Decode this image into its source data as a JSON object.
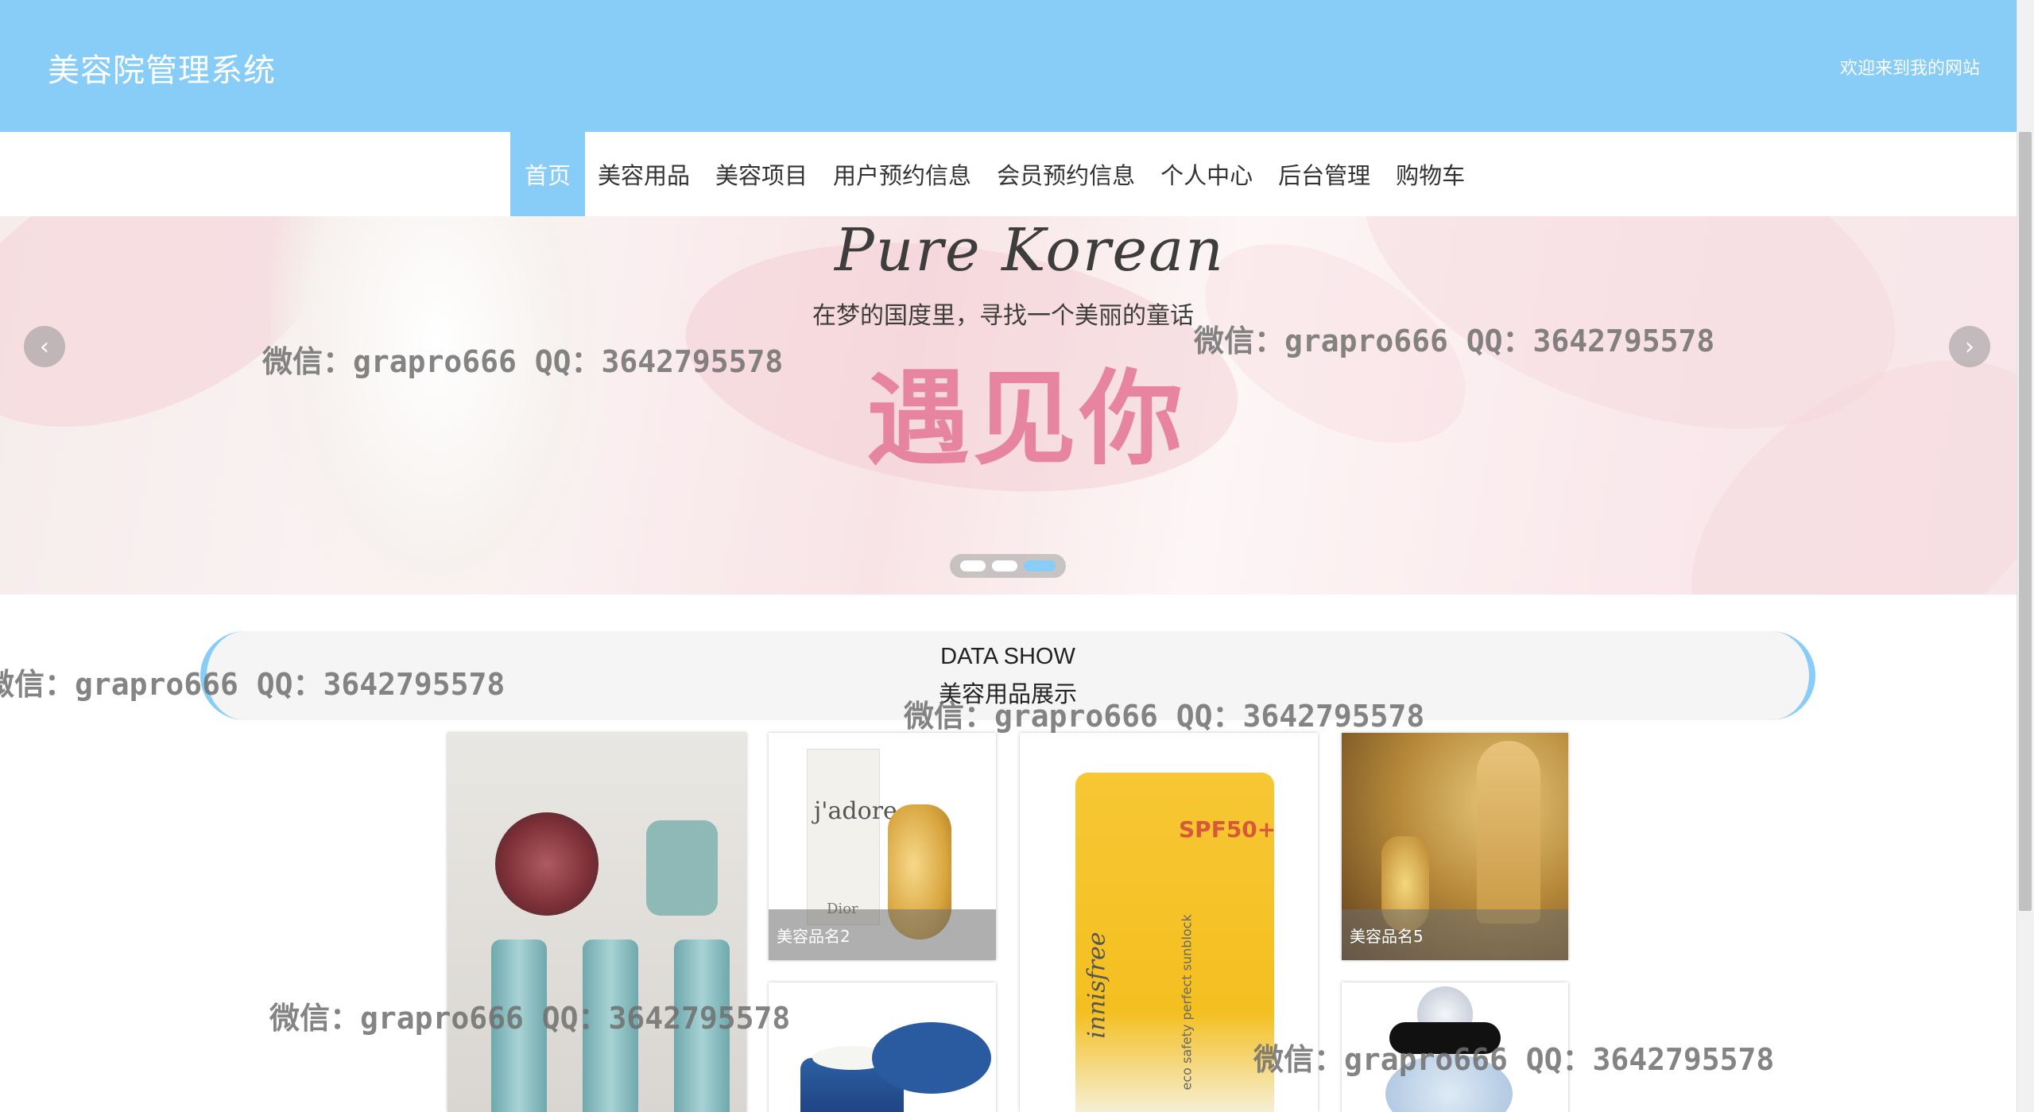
{
  "header": {
    "site_title": "美容院管理系统",
    "welcome": "欢迎来到我的网站"
  },
  "nav": {
    "items": [
      {
        "label": "首页",
        "active": true
      },
      {
        "label": "美容用品",
        "active": false
      },
      {
        "label": "美容项目",
        "active": false
      },
      {
        "label": "用户预约信息",
        "active": false
      },
      {
        "label": "会员预约信息",
        "active": false
      },
      {
        "label": "个人中心",
        "active": false
      },
      {
        "label": "后台管理",
        "active": false
      },
      {
        "label": "购物车",
        "active": false
      }
    ]
  },
  "banner": {
    "script_title": "Pure Korean",
    "subtitle": "在梦的国度里，寻找一个美丽的童话",
    "big_text": "遇见你",
    "prev_icon": "chevron-left-icon",
    "next_icon": "chevron-right-icon",
    "prev_glyph": "‹",
    "next_glyph": "›",
    "slide_count": 3,
    "active_slide": 3
  },
  "section": {
    "title_en": "DATA SHOW",
    "title_cn": "美容用品展示"
  },
  "products": [
    {
      "caption": ""
    },
    {
      "caption": "美容品名2"
    },
    {
      "caption": ""
    },
    {
      "caption": "美容品名5"
    },
    {
      "caption": ""
    },
    {
      "caption": ""
    }
  ],
  "product_art": {
    "jadore": "j'adore",
    "dior": "Dior",
    "spf": "SPF50+",
    "innisfree": "innisfree",
    "sunblock": "eco safety perfect sunblock"
  },
  "watermark": "微信：grapro666 QQ：3642795578",
  "colors": {
    "accent": "#88cdf8",
    "nav_text": "#333333",
    "banner_pink": "#e785a0"
  }
}
